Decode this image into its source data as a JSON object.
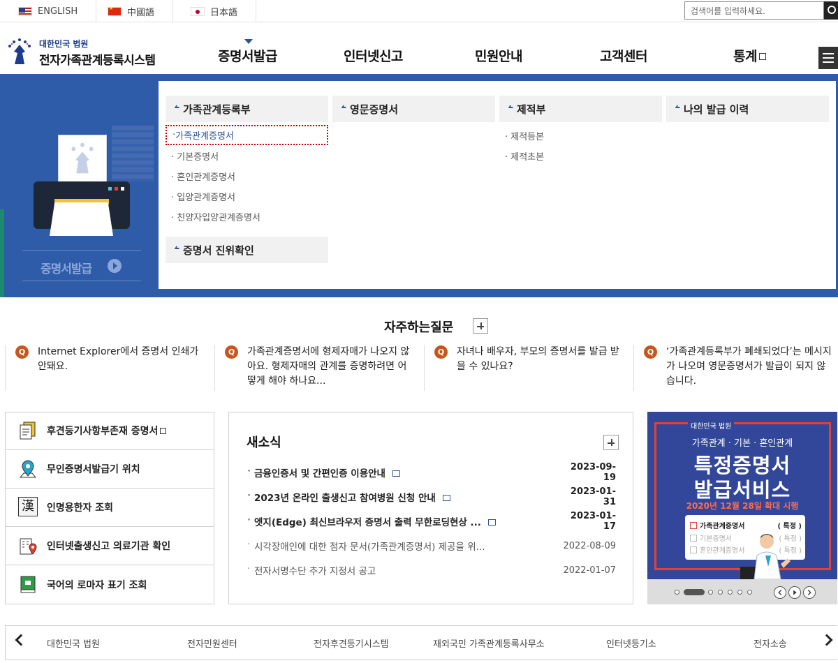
{
  "languages": [
    {
      "label": "ENGLISH",
      "flag": "us-flag-icon"
    },
    {
      "label": "中國語",
      "flag": "cn-flag-icon"
    },
    {
      "label": "日本語",
      "flag": "jp-flag-icon"
    }
  ],
  "search": {
    "placeholder": "검색어를 입력하세요."
  },
  "logo": {
    "org": "대한민국 법원",
    "title": "전자가족관계등록시스템"
  },
  "gnb": [
    "증명서발급",
    "인터넷신고",
    "민원안내",
    "고객센터",
    "통계"
  ],
  "dropdown": {
    "side_label": "증명서발급",
    "columns": [
      {
        "category": "가족관계등록부",
        "items": [
          "가족관계증명서",
          "기본증명서",
          "혼인관계증명서",
          "입양관계증명서",
          "친양자입양관계증명서"
        ]
      },
      {
        "category": "영문증명서",
        "items": []
      },
      {
        "category": "제적부",
        "items": [
          "제적등본",
          "제적초본"
        ]
      },
      {
        "category": "나의 발급 이력",
        "items": []
      }
    ],
    "extra_category": "증명서 진위확인"
  },
  "faq": {
    "title": "자주하는질문",
    "badge": "Q",
    "items": [
      "Internet Explorer에서 증명서 인쇄가 안돼요.",
      "가족관계증명서에 형제자매가 나오지 않아요. 형제자매의 관계를 증명하려면 어떻게 해야 하나요...",
      "자녀나 배우자, 부모의 증명서를 발급 받을 수 있나요?",
      "‘가족관계등록부가 폐쇄되었다’는 메시지가 나오며 영문증명서가 발급이 되지 않습니다."
    ]
  },
  "quick_links": [
    {
      "label": "후견등기사항부존재 증명서",
      "icon": "document-icon"
    },
    {
      "label": "무인증명서발급기 위치",
      "icon": "location-pin-icon"
    },
    {
      "label": "인명용한자 조회",
      "icon": "hanja-book-icon",
      "glyph": "漢"
    },
    {
      "label": "인터넷출생신고 의료기관 확인",
      "icon": "hospital-icon"
    },
    {
      "label": "국어의 로마자 표기 조회",
      "icon": "green-book-icon"
    }
  ],
  "news": {
    "title": "새소식",
    "items": [
      {
        "title": "금융인증서 및 간편인증 이용안내",
        "date": "2023-09-19"
      },
      {
        "title": "2023년 온라인 출생신고 참여병원 신청 안내",
        "date": "2023-01-31"
      },
      {
        "title": "엣지(Edge) 최신브라우저 증명서 출력 무한로딩현상 ...",
        "date": "2023-01-17"
      },
      {
        "title": "시각장애인에 대한 점자 문서(가족관계증명서) 제공을 위...",
        "date": "2022-08-09"
      },
      {
        "title": "전자서명수단 추가 지정서 공고",
        "date": "2022-01-07"
      }
    ]
  },
  "banner": {
    "court": "대한민국 법원",
    "line1": "가족관계 · 기본 · 혼인관계",
    "line2": "특정증명서",
    "line3": "발급서비스",
    "line4": "2020년 12월 28일 확대 시행",
    "card": [
      {
        "label": "가족관계증명서",
        "spec": "( 특정 )"
      },
      {
        "label": "기본증명서",
        "spec": "( 특정 )"
      },
      {
        "label": "혼인관계증명서",
        "spec": "( 특정 )"
      }
    ]
  },
  "footer_links": [
    "대한민국 법원",
    "전자민원센터",
    "전자후견등기시스템",
    "재외국민 가족관계등록사무소",
    "인터넷등기소",
    "전자소송"
  ],
  "colors": {
    "brand": "#2f5ca8",
    "faq_badge": "#c8561a",
    "banner_bg": "#32479a",
    "banner_accent": "#e8402c"
  }
}
